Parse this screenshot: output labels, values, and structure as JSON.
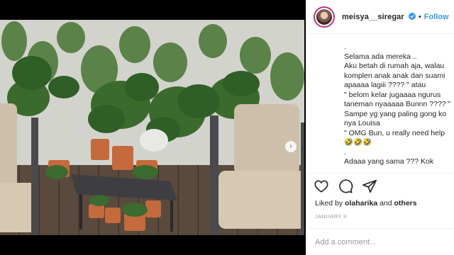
{
  "post": {
    "username": "meisya__siregar",
    "separator": "•",
    "follow_label": "Follow",
    "caption_lines": [
      ".",
      "Selama ada mereka ..",
      "Aku betah di rumah aja, walau",
      "komplen anak anak dan suami",
      "apaaaa lagiii ???? \" atau",
      "\" belom kelar jugaaaa ngurus",
      "taneman nyaaaaa Bunnn ???? \"",
      "Sampe yg yang paling gong ko",
      "nya Louisa",
      "\" OMG Bun, u really need help",
      "🤣🤣🤣",
      ".",
      "Adaaa yang sama ??? Kok"
    ],
    "likes": {
      "prefix": "Liked by",
      "user": "olaharika",
      "connector": "and",
      "others": "others"
    },
    "date": "JANUARY 9",
    "comment_placeholder": "Add a comment..."
  },
  "carousel": {
    "next_glyph": "›",
    "total_slides": 9,
    "active_index": 0
  },
  "icons": {
    "verified": "verified-badge-icon",
    "like": "heart-icon",
    "comment": "comment-bubble-icon",
    "share": "share-arrow-icon"
  },
  "colors": {
    "accent": "#3897f0",
    "text": "#262626",
    "muted": "#999999",
    "avatar_ring": "#c13584"
  }
}
